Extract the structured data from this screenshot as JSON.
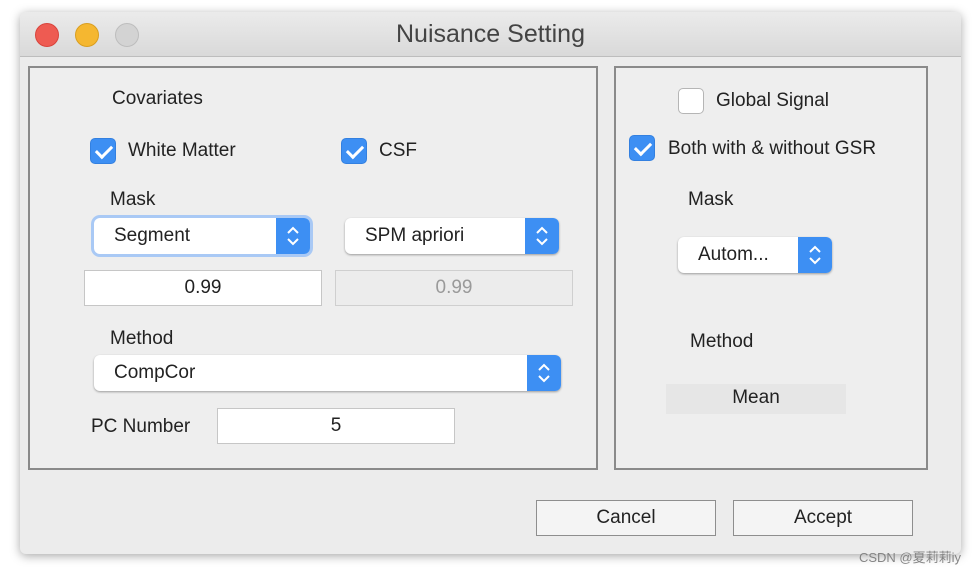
{
  "window": {
    "title": "Nuisance Setting"
  },
  "left_panel": {
    "covariates_label": "Covariates",
    "white_matter": {
      "label": "White Matter",
      "checked": true
    },
    "csf": {
      "label": "CSF",
      "checked": true
    },
    "mask_label": "Mask",
    "wm_mask_select": "Segment",
    "csf_mask_select": "SPM apriori",
    "wm_threshold": "0.99",
    "csf_threshold": "0.99",
    "method_label": "Method",
    "method_select": "CompCor",
    "pc_number_label": "PC Number",
    "pc_number": "5"
  },
  "right_panel": {
    "global_signal": {
      "label": "Global Signal",
      "checked": false
    },
    "both_gsr": {
      "label": "Both with & without GSR",
      "checked": true
    },
    "mask_label": "Mask",
    "mask_select": "Autom...",
    "method_label": "Method",
    "method_value": "Mean"
  },
  "buttons": {
    "cancel": "Cancel",
    "accept": "Accept"
  },
  "watermark": "CSDN @夏莉莉iy",
  "colors": {
    "accent": "#3d8ff3",
    "window_bg": "#ececec"
  }
}
